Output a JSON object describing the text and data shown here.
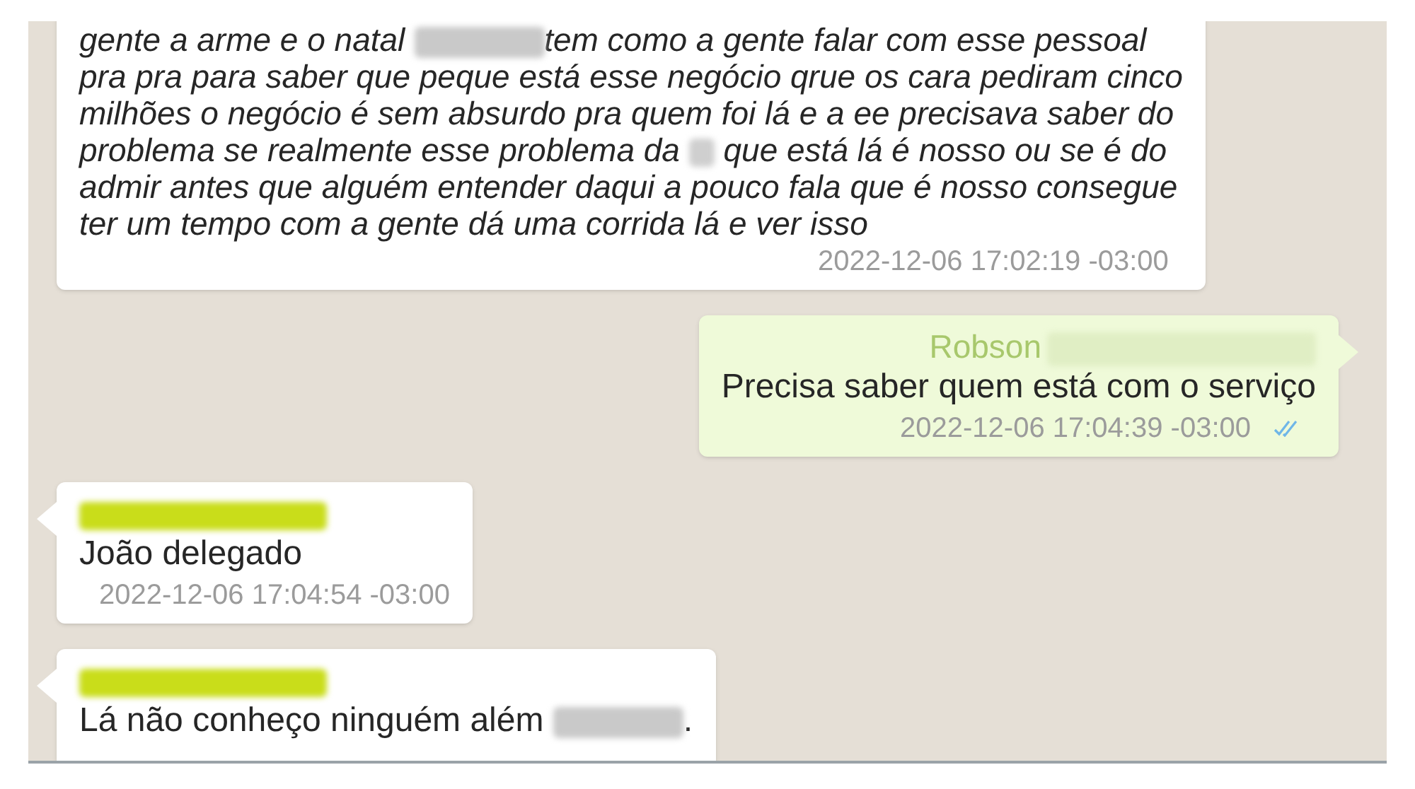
{
  "messages": [
    {
      "kind": "incoming",
      "italic": true,
      "body": [
        {
          "kind": "text",
          "text": "gente a arme e o natal "
        },
        {
          "kind": "redacted"
        },
        {
          "kind": "text",
          "text": "tem como a gente falar com esse pessoal"
        },
        {
          "kind": "break"
        },
        {
          "kind": "text",
          "text": "pra pra para saber que peque está esse negócio qrue os cara pediram cinco"
        },
        {
          "kind": "break"
        },
        {
          "kind": "text",
          "text": "milhões o negócio é sem absurdo pra quem foi lá e a ee precisava saber do"
        },
        {
          "kind": "break"
        },
        {
          "kind": "text",
          "text": "problema se realmente esse problema da "
        },
        {
          "kind": "redacted_short"
        },
        {
          "kind": "text",
          "text": " que está lá é nosso ou se é do"
        },
        {
          "kind": "break"
        },
        {
          "kind": "text",
          "text": "admir antes que alguém entender daqui a pouco fala que é nosso consegue"
        },
        {
          "kind": "break"
        },
        {
          "kind": "text",
          "text": "ter um tempo com a gente dá uma corrida lá e ver isso"
        }
      ],
      "time": "2022-12-06 17:02:19 -03:00",
      "read": false
    },
    {
      "kind": "outgoing",
      "italic": false,
      "sender": [
        {
          "kind": "text",
          "text": "Robson"
        },
        {
          "kind": "redacted_name"
        }
      ],
      "body": [
        {
          "kind": "text",
          "text": "Precisa saber quem está com o serviço"
        }
      ],
      "time": "2022-12-06 17:04:39 -03:00",
      "read": true
    },
    {
      "kind": "incoming",
      "italic": false,
      "sender": [
        {
          "kind": "highlighted_redacted"
        }
      ],
      "body": [
        {
          "kind": "text",
          "text": "João delegado"
        }
      ],
      "time": "2022-12-06 17:04:54 -03:00",
      "read": false
    },
    {
      "kind": "incoming",
      "italic": false,
      "sender": [
        {
          "kind": "highlighted_redacted"
        }
      ],
      "body": [
        {
          "kind": "text",
          "text": "Lá não conheço ninguém além "
        },
        {
          "kind": "redacted"
        },
        {
          "kind": "text",
          "text": "."
        }
      ],
      "read": false
    }
  ]
}
